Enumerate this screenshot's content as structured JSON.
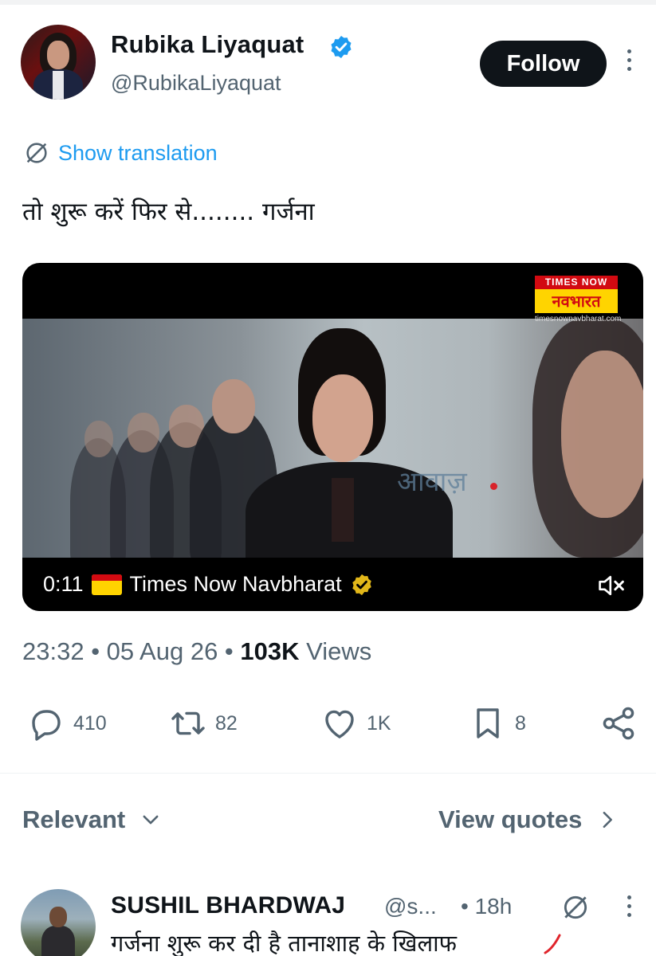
{
  "author": {
    "name": "Rubika Liyaquat",
    "handle": "@RubikaLiyaquat",
    "verified_icon": "verified-badge-icon",
    "follow_label": "Follow"
  },
  "translation": {
    "label": "Show translation",
    "icon": "translate-icon"
  },
  "tweet": {
    "text": "तो शुरू करें फिर से........ गर्जना"
  },
  "video": {
    "time": "0:11",
    "source": "Times Now Navbharat",
    "logo_top": "TIMES NOW",
    "logo_main": "नवभारत",
    "logo_url": "timesnownavbharat.com",
    "overlay_word": "आवाज़",
    "mute_icon": "mute-icon"
  },
  "meta": {
    "time": "23:32",
    "date": "05 Aug 26",
    "views_count": "103K",
    "views_label": "Views"
  },
  "actions": {
    "replies": "410",
    "reposts": "82",
    "likes": "1K",
    "bookmarks": "8"
  },
  "sort": {
    "relevant_label": "Relevant",
    "view_quotes_label": "View quotes"
  },
  "reply": {
    "name": "SUSHIL BHARDWAJ",
    "handle": "@s...",
    "time": "• 18h",
    "text": "गर्जना शुरू कर दी है तानाशाह के खिलाफ"
  },
  "colors": {
    "accent": "#1d9bf0",
    "text_primary": "#0f1419",
    "text_secondary": "#536471",
    "verified_blue": "#1d9bf0",
    "verified_gold": "#e2b719"
  }
}
